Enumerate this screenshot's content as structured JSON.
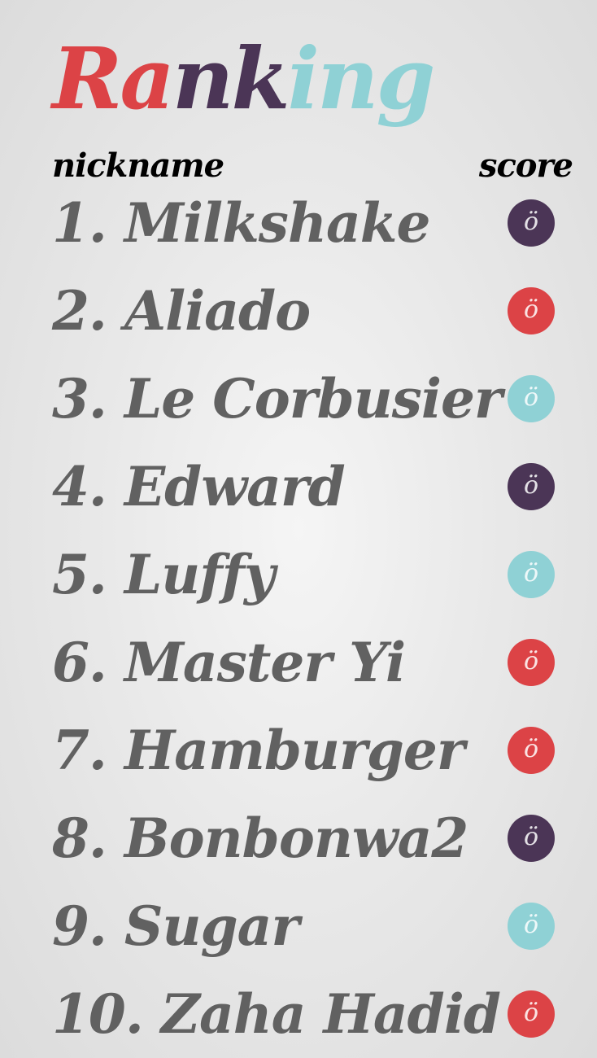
{
  "title": {
    "letters": [
      {
        "char": "R",
        "color": "#dc4346"
      },
      {
        "char": "a",
        "color": "#dc4346"
      },
      {
        "char": "n",
        "color": "#4b3556"
      },
      {
        "char": "k",
        "color": "#4b3556"
      },
      {
        "char": "i",
        "color": "#8fd1d5"
      },
      {
        "char": "n",
        "color": "#8fd1d5"
      },
      {
        "char": "g",
        "color": "#8fd1d5"
      }
    ]
  },
  "headers": {
    "nickname": "nickname",
    "score": "score"
  },
  "colors": {
    "purple": "#4b3556",
    "red": "#dc4346",
    "teal": "#8fd1d5",
    "text": "#616161"
  },
  "rows": [
    {
      "label": "1. Milkshake",
      "badge_color": "#4b3556",
      "badge_glyph": "ö"
    },
    {
      "label": "2. Aliado",
      "badge_color": "#dc4346",
      "badge_glyph": "ö"
    },
    {
      "label": "3. Le Corbusier",
      "badge_color": "#8fd1d5",
      "badge_glyph": "ö"
    },
    {
      "label": "4. Edward",
      "badge_color": "#4b3556",
      "badge_glyph": "ö"
    },
    {
      "label": "5. Luffy",
      "badge_color": "#8fd1d5",
      "badge_glyph": "ö"
    },
    {
      "label": "6. Master Yi",
      "badge_color": "#dc4346",
      "badge_glyph": "ö"
    },
    {
      "label": "7. Hamburger",
      "badge_color": "#dc4346",
      "badge_glyph": "ö"
    },
    {
      "label": "8. Bonbonwa2",
      "badge_color": "#4b3556",
      "badge_glyph": "ö"
    },
    {
      "label": "9. Sugar",
      "badge_color": "#8fd1d5",
      "badge_glyph": "ö"
    },
    {
      "label": "10. Zaha Hadid",
      "badge_color": "#dc4346",
      "badge_glyph": "ö"
    }
  ]
}
